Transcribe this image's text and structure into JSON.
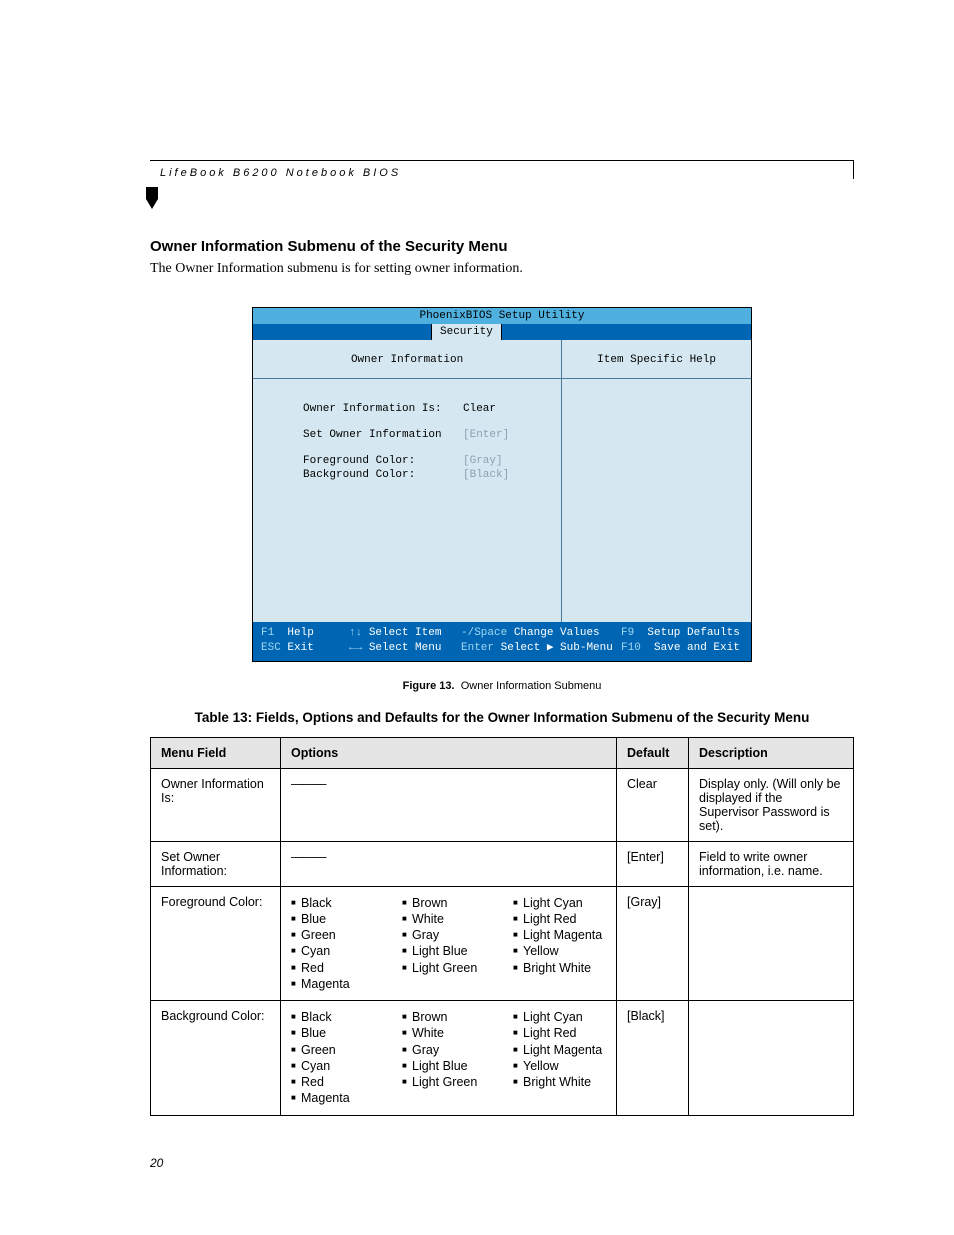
{
  "header": {
    "running": "LifeBook B6200 Notebook BIOS"
  },
  "section": {
    "title": "Owner Information Submenu of the Security Menu",
    "intro": "The Owner Information submenu is for setting owner information."
  },
  "bios": {
    "title": "PhoenixBIOS Setup Utility",
    "tab": "Security",
    "panel_title": "Owner Information",
    "help_title": "Item Specific Help",
    "rows": [
      {
        "label": "Owner Information Is:",
        "value": "Clear",
        "dim": false
      },
      {
        "label": "Set Owner Information",
        "value": "[Enter]",
        "dim": true
      },
      {
        "label": "Foreground Color:",
        "value": "[Gray]",
        "dim": true
      },
      {
        "label": "Background Color:",
        "value": "[Black]",
        "dim": true
      }
    ],
    "footer": {
      "r1": {
        "a_key": "F1",
        "a_txt": "Help",
        "b_key": "↑↓",
        "b_txt": "Select Item",
        "c_key": "-/Space",
        "c_txt": "Change Values",
        "d_key": "F9",
        "d_txt": "Setup Defaults"
      },
      "r2": {
        "a_key": "ESC",
        "a_txt": "Exit",
        "b_key": "←→",
        "b_txt": "Select Menu",
        "c_key": "Enter",
        "c_txt": "Select ▶ Sub-Menu",
        "d_key": "F10",
        "d_txt": "Save and Exit"
      }
    }
  },
  "figure": {
    "label": "Figure 13.",
    "text": "Owner Information Submenu"
  },
  "table": {
    "title": "Table 13: Fields, Options and Defaults for the Owner Information Submenu of the Security Menu",
    "headers": {
      "c1": "Menu Field",
      "c2": "Options",
      "c3": "Default",
      "c4": "Description"
    },
    "dash": "———",
    "rows": [
      {
        "field": "Owner Information Is:",
        "options_type": "dash",
        "default": "Clear",
        "description": "Display only. (Will only be displayed if the Supervisor Password is set)."
      },
      {
        "field": "Set Owner Information:",
        "options_type": "dash",
        "default": "[Enter]",
        "description": "Field to write owner information, i.e. name."
      },
      {
        "field": "Foreground Color:",
        "options_type": "colors",
        "default": "[Gray]",
        "description": ""
      },
      {
        "field": "Background Color:",
        "options_type": "colors",
        "default": "[Black]",
        "description": ""
      }
    ],
    "color_columns": [
      [
        "Black",
        "Blue",
        "Green",
        "Cyan",
        "Red",
        "Magenta"
      ],
      [
        "Brown",
        "White",
        "Gray",
        "Light Blue",
        "Light Green"
      ],
      [
        "Light Cyan",
        "Light Red",
        "Light Magenta",
        "Yellow",
        "Bright White"
      ]
    ]
  },
  "page_number": "20"
}
